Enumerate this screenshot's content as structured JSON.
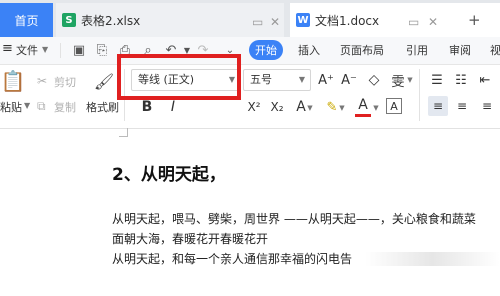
{
  "tabs": {
    "home": "首页",
    "xlsx": "表格2.xlsx",
    "docx": "文档1.docx"
  },
  "menu": {
    "file": "文件",
    "start": "开始",
    "insert": "插入",
    "page_layout": "页面布局",
    "reference": "引用",
    "review": "审阅",
    "view": "视"
  },
  "ribbon": {
    "cut": "剪切",
    "copy": "复制",
    "paste": "粘贴",
    "format_painter": "格式刷",
    "font_name": "等线 (正文)",
    "font_size": "五号"
  },
  "document": {
    "heading": "2、从明天起，",
    "line1": "从明天起，喂马、劈柴，周世界 ——从明天起——，关心粮食和蔬菜",
    "line2": "面朝大海，春暖花开春暖花开",
    "line3": "从明天起，和每一个亲人通信那幸福的闪电告"
  },
  "colors": {
    "accent": "#3b82f6",
    "highlight_border": "#e02020",
    "tab_bar": "#e4e7eb",
    "xlsx_icon": "#1fa463",
    "docx_icon": "#3b82f6"
  }
}
